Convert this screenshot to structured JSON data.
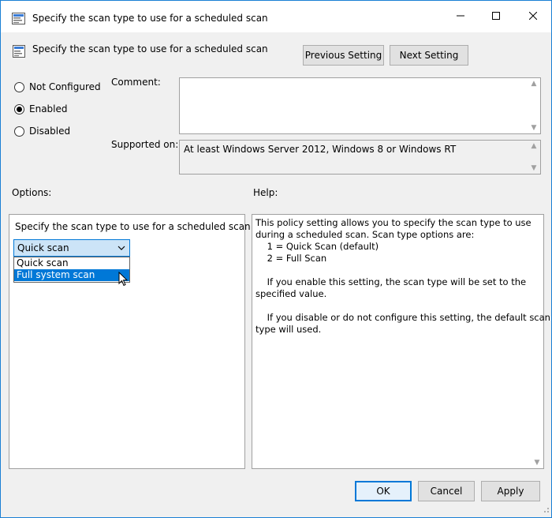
{
  "window": {
    "title": "Specify the scan type to use for a scheduled scan"
  },
  "header": {
    "title": "Specify the scan type to use for a scheduled scan",
    "previous_label": "Previous Setting",
    "next_label": "Next Setting"
  },
  "state": {
    "options": [
      {
        "label": "Not Configured",
        "checked": false
      },
      {
        "label": "Enabled",
        "checked": true
      },
      {
        "label": "Disabled",
        "checked": false
      }
    ]
  },
  "comment": {
    "label": "Comment:",
    "value": ""
  },
  "supported": {
    "label": "Supported on:",
    "value": "At least Windows Server 2012, Windows 8 or Windows RT"
  },
  "options_section": {
    "label": "Options:",
    "setting_label": "Specify the scan type to use for a scheduled scan",
    "combo_value": "Quick scan",
    "dropdown_items": [
      "Quick scan",
      "Full system scan"
    ],
    "highlighted_item": "Full system scan"
  },
  "help_section": {
    "label": "Help:",
    "lines": [
      "This policy setting allows you to specify the scan type to use",
      "during a scheduled scan. Scan type options are:",
      "    1 = Quick Scan (default)",
      "    2 = Full Scan",
      "",
      "    If you enable this setting, the scan type will be set to the",
      "specified value.",
      "",
      "    If you disable or do not configure this setting, the default scan",
      "type will used."
    ]
  },
  "footer": {
    "ok_label": "OK",
    "cancel_label": "Cancel",
    "apply_label": "Apply"
  },
  "colors": {
    "accent": "#0078d7",
    "highlight_text": "#ffffff",
    "window_bg": "#f0f0f0"
  }
}
